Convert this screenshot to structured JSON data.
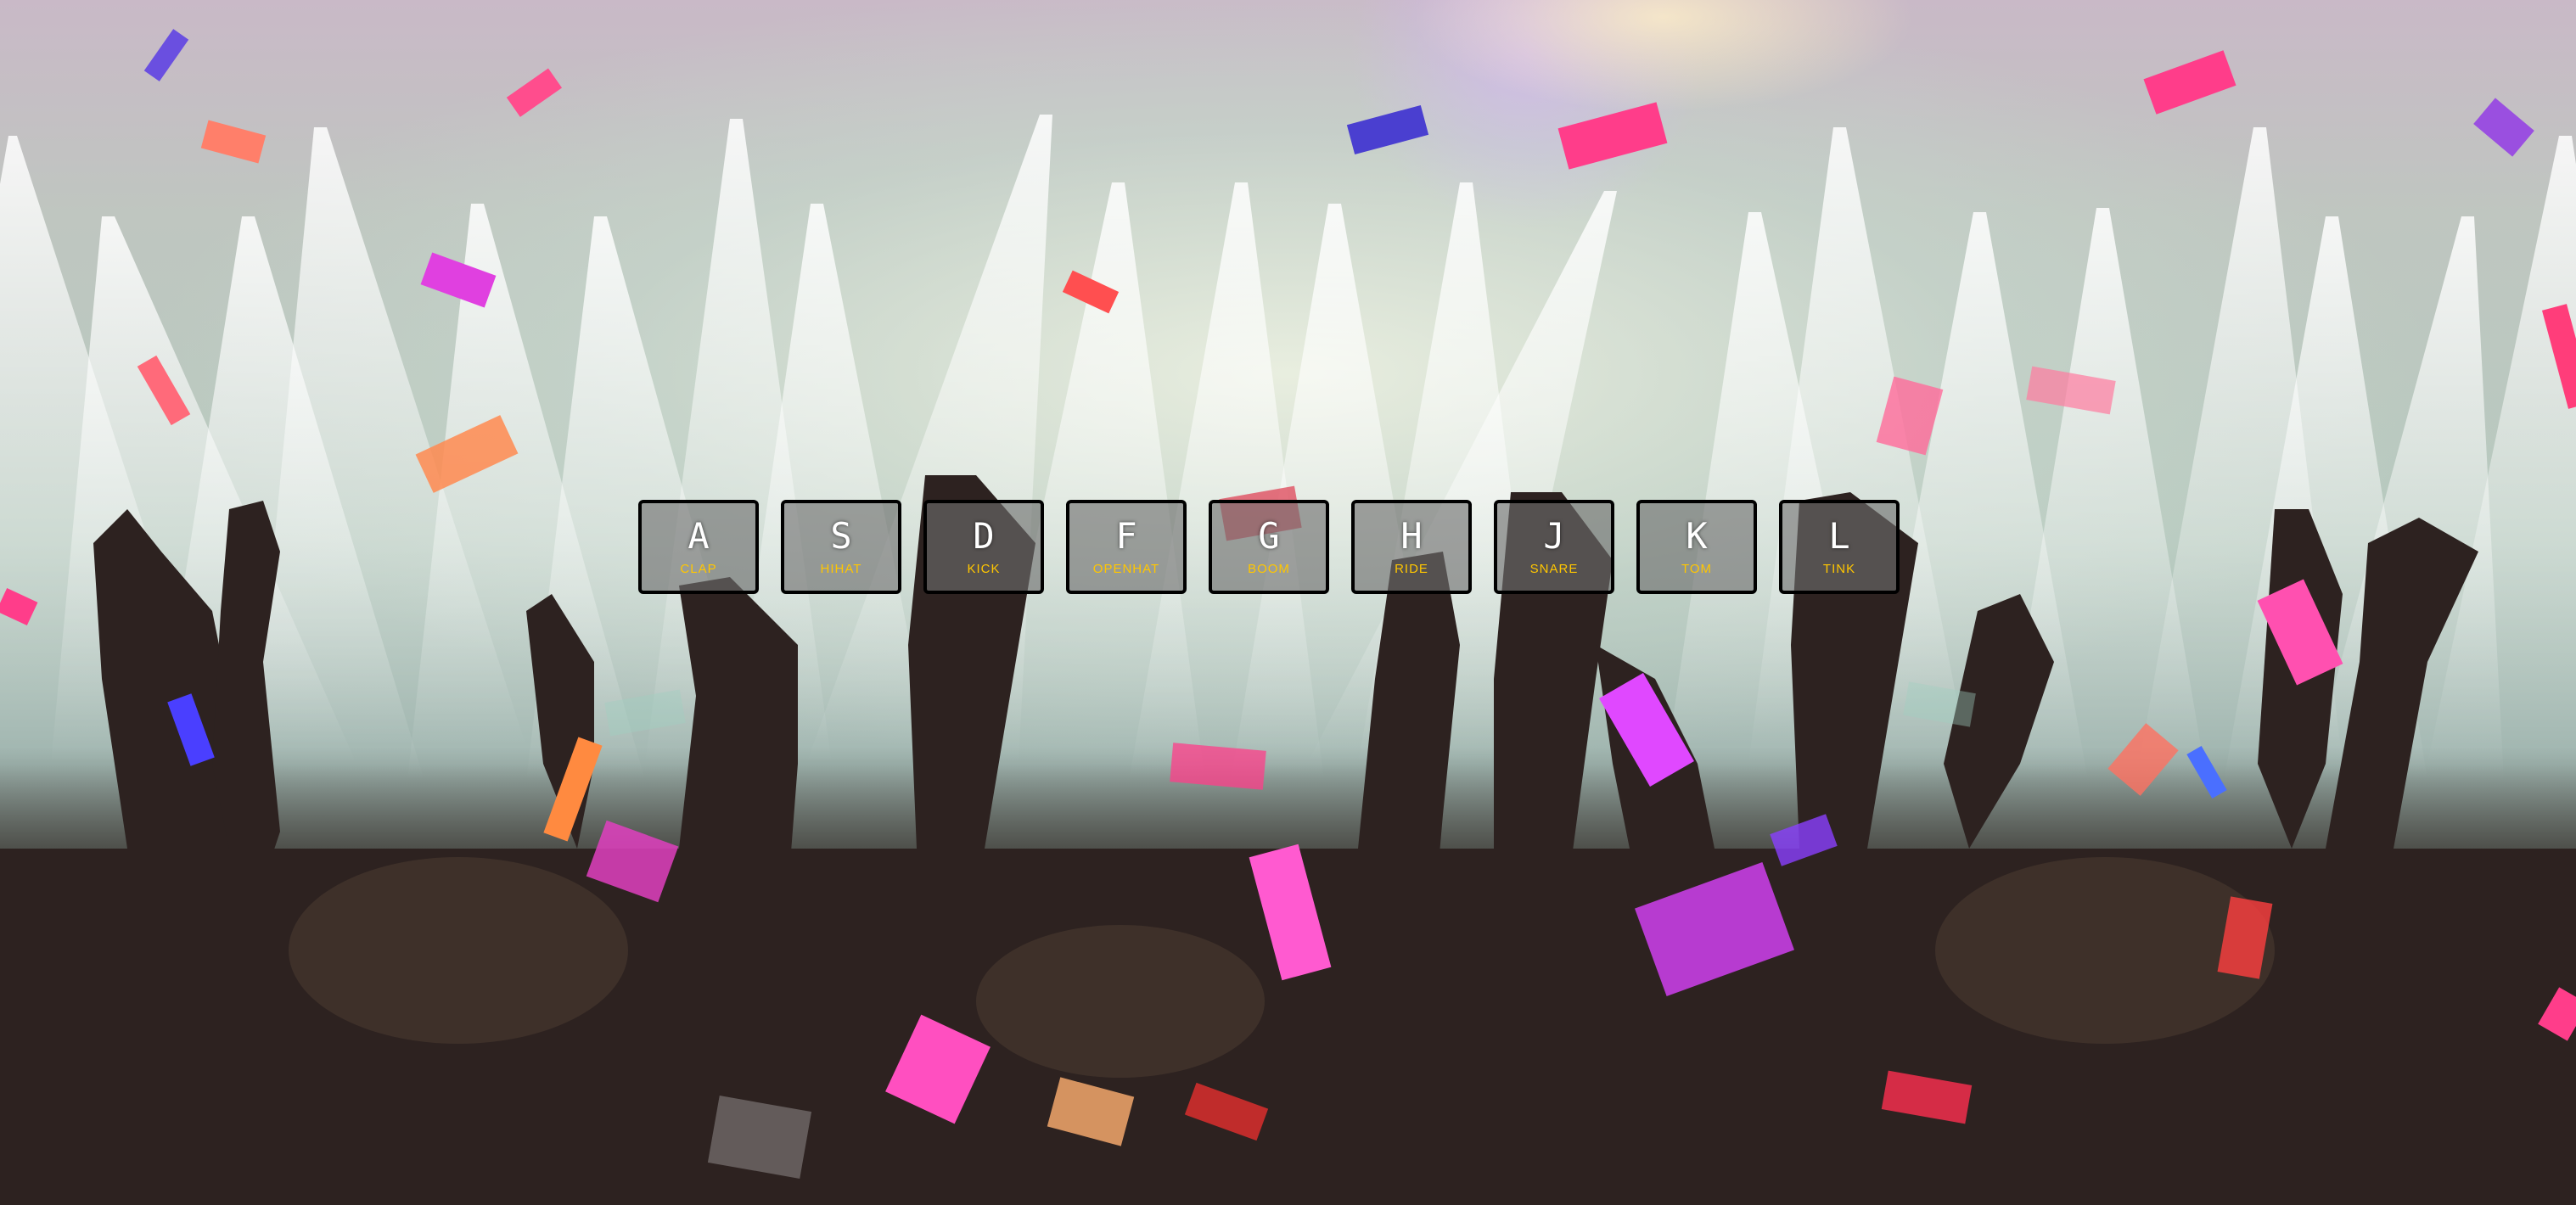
{
  "drum_kit": {
    "keys": [
      {
        "letter": "A",
        "sound": "CLAP"
      },
      {
        "letter": "S",
        "sound": "HIHAT"
      },
      {
        "letter": "D",
        "sound": "KICK"
      },
      {
        "letter": "F",
        "sound": "OPENHAT"
      },
      {
        "letter": "G",
        "sound": "BOOM"
      },
      {
        "letter": "H",
        "sound": "RIDE"
      },
      {
        "letter": "J",
        "sound": "SNARE"
      },
      {
        "letter": "K",
        "sound": "TOM"
      },
      {
        "letter": "L",
        "sound": "TINK"
      }
    ]
  },
  "colors": {
    "key_border": "#000000",
    "letter": "#ffffff",
    "sound_label": "#ffc600"
  }
}
